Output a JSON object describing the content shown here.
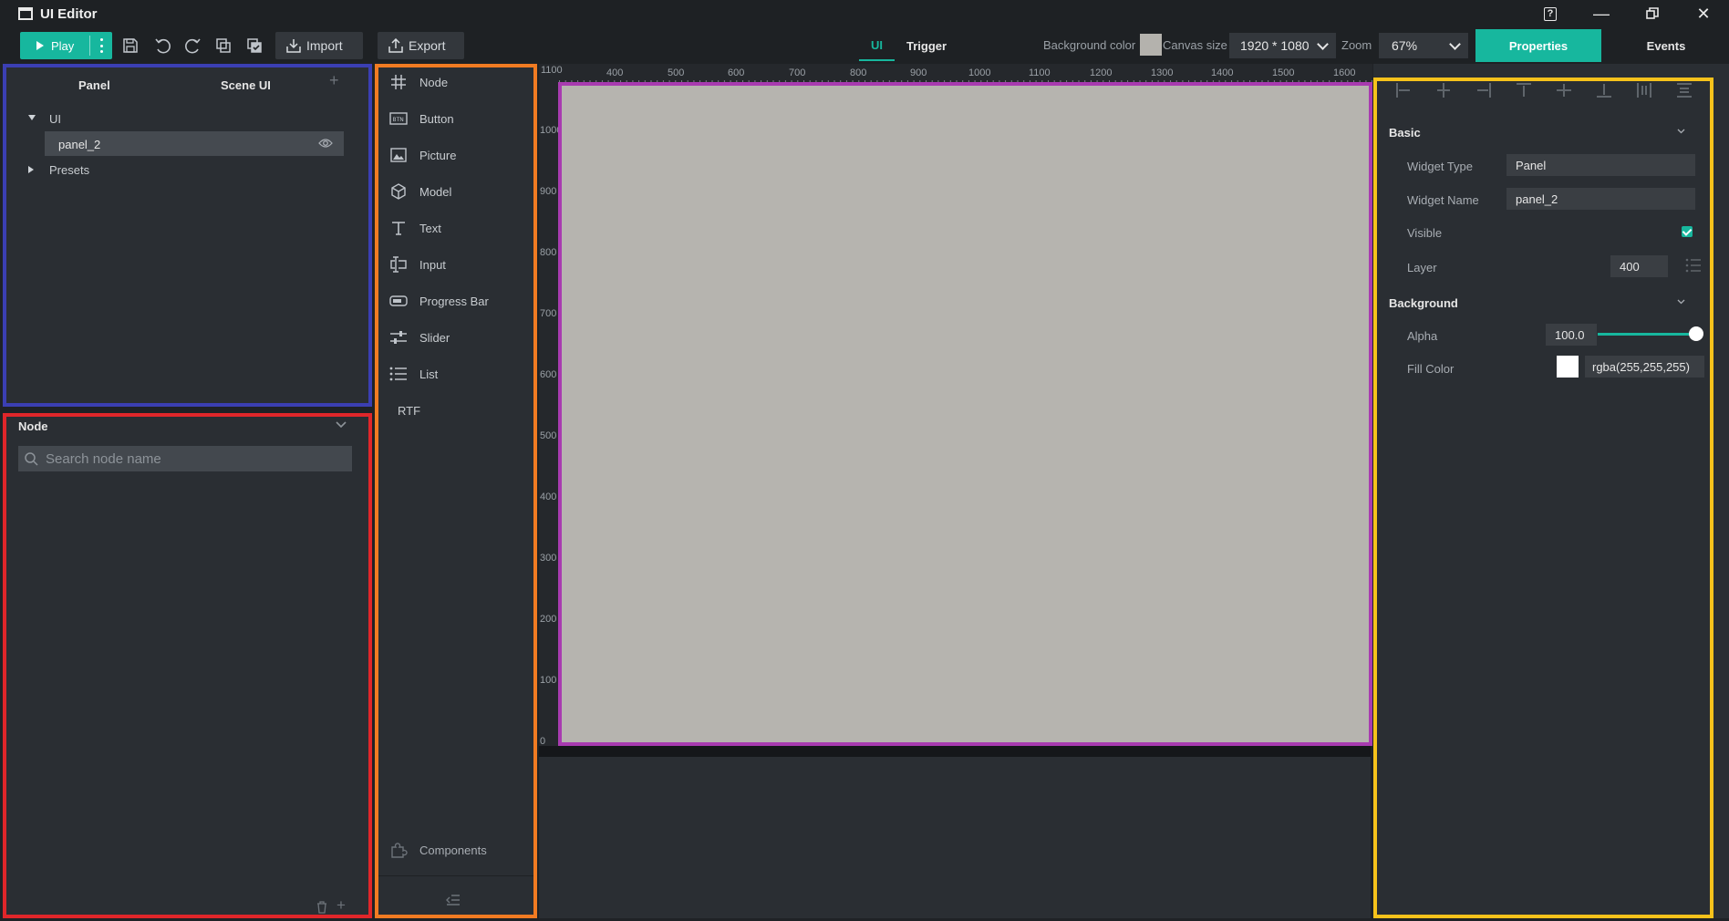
{
  "window": {
    "title": "UI Editor"
  },
  "toolbar": {
    "play_label": "Play",
    "import_label": "Import",
    "export_label": "Export",
    "mode_tabs": [
      "UI",
      "Trigger"
    ],
    "background_color_label": "Background color",
    "background_color": "#b4b2ad",
    "canvas_size_label": "Canvas size",
    "canvas_size_value": "1920 * 1080",
    "zoom_label": "Zoom",
    "zoom_value": "67%",
    "properties_tab": "Properties",
    "events_tab": "Events"
  },
  "panel_tree": {
    "tabs": [
      "Panel",
      "Scene UI"
    ],
    "root_label": "UI",
    "selected_item": "panel_2",
    "presets_label": "Presets"
  },
  "node_panel": {
    "title": "Node",
    "search_placeholder": "Search node name"
  },
  "widgets": {
    "items": [
      "Node",
      "Button",
      "Picture",
      "Model",
      "Text",
      "Input",
      "Progress Bar",
      "Slider",
      "List",
      "RTF"
    ],
    "components_label": "Components"
  },
  "ruler": {
    "top_ticks": [
      "1100",
      "400",
      "500",
      "600",
      "700",
      "800",
      "900",
      "1000",
      "1100",
      "1200",
      "1300",
      "1400",
      "1500",
      "1600"
    ],
    "left_ticks": [
      "1000",
      "900",
      "800",
      "700",
      "600",
      "500",
      "400",
      "300",
      "200",
      "100",
      "0"
    ]
  },
  "properties": {
    "basic_title": "Basic",
    "widget_type_label": "Widget Type",
    "widget_type_value": "Panel",
    "widget_name_label": "Widget Name",
    "widget_name_value": "panel_2",
    "visible_label": "Visible",
    "layer_label": "Layer",
    "layer_value": "400",
    "background_title": "Background",
    "alpha_label": "Alpha",
    "alpha_value": "100.0",
    "fill_color_label": "Fill Color",
    "fill_color_value": "rgba(255,255,255)"
  },
  "colors": {
    "accent": "#17b79e",
    "canvas": "#b6b4af"
  }
}
